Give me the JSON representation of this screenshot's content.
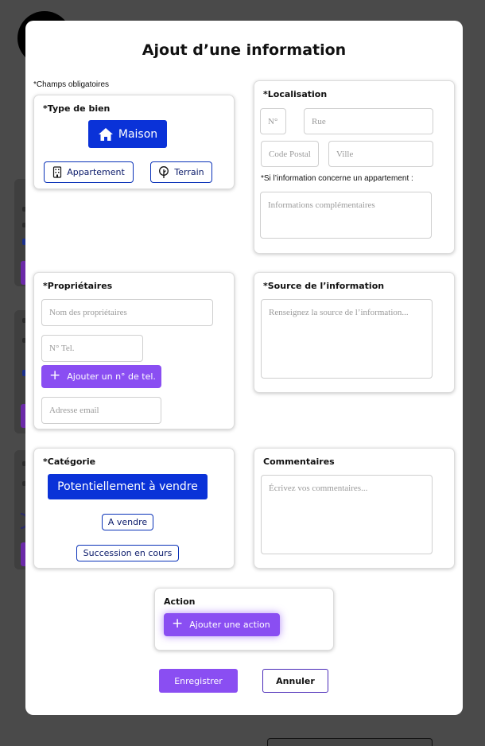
{
  "modal": {
    "title": "Ajout d’une information",
    "required_note": "*Champs obligatoires"
  },
  "type_de_bien": {
    "title": "*Type de bien",
    "options": [
      {
        "label": "Maison",
        "icon": "house-icon",
        "selected": true
      },
      {
        "label": "Appartement",
        "icon": "building-icon",
        "selected": false
      },
      {
        "label": "Terrain",
        "icon": "tree-icon",
        "selected": false
      }
    ]
  },
  "localisation": {
    "title": "*Localisation",
    "numero_placeholder": "N°",
    "rue_placeholder": "Rue",
    "code_postal_placeholder": "Code Postal",
    "ville_placeholder": "Ville",
    "appartement_note": "*Si l’information concerne un appartement :",
    "complement_placeholder": "Informations complémentaires"
  },
  "proprietaires": {
    "title": "*Propriétaires",
    "nom_placeholder": "Nom des propriétaires",
    "tel_placeholder": "N° Tel.",
    "add_tel_label": "Ajouter un n° de tel.",
    "email_placeholder": "Adresse email"
  },
  "source": {
    "title": "*Source de l’information",
    "placeholder": "Renseignez la source de l’information..."
  },
  "categorie": {
    "title": "*Catégorie",
    "options": [
      {
        "label": "Potentiellement à vendre",
        "selected": true
      },
      {
        "label": "A vendre",
        "selected": false
      },
      {
        "label": "Succession en cours",
        "selected": false
      }
    ]
  },
  "commentaires": {
    "title": "Commentaires",
    "placeholder": "Écrivez vos commentaires..."
  },
  "action": {
    "title": "Action",
    "add_label": "Ajouter une action"
  },
  "footer": {
    "save_label": "Enregistrer",
    "cancel_label": "Annuler"
  },
  "colors": {
    "primary_blue": "#0a32d8",
    "accent_purple": "#8a4ef2",
    "overlay": "#4a4a4a"
  }
}
